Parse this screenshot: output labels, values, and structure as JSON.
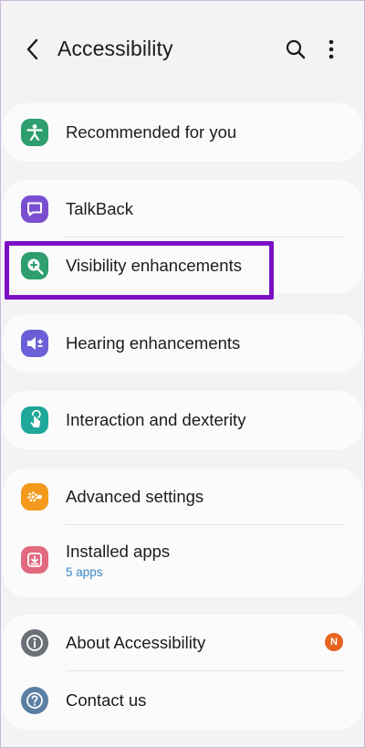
{
  "header": {
    "title": "Accessibility",
    "back_icon": "chevron-left-icon",
    "search_icon": "search-icon",
    "more_icon": "more-vertical-icon"
  },
  "sections": {
    "recommended": {
      "label": "Recommended for you",
      "icon": "accessibility-person-icon",
      "color": "#2e9e6f"
    },
    "talkback": {
      "label": "TalkBack",
      "icon": "chat-bubble-icon",
      "color": "#7a4fcf"
    },
    "visibility": {
      "label": "Visibility enhancements",
      "icon": "zoom-in-icon",
      "color": "#2e9e6f"
    },
    "hearing": {
      "label": "Hearing enhancements",
      "icon": "volume-icon",
      "color": "#6a5fd6"
    },
    "interaction": {
      "label": "Interaction and dexterity",
      "icon": "touch-hand-icon",
      "color": "#1fa89a"
    },
    "advanced": {
      "label": "Advanced settings",
      "icon": "gears-icon",
      "color": "#f39a1d"
    },
    "installed": {
      "label": "Installed apps",
      "sublabel": "5 apps",
      "icon": "download-icon",
      "color": "#e26a7e"
    },
    "about": {
      "label": "About Accessibility",
      "icon": "info-icon",
      "color": "#6b6f76",
      "badge": "N"
    },
    "contact": {
      "label": "Contact us",
      "icon": "question-icon",
      "color": "#5a7fa3"
    }
  },
  "colors": {
    "highlight": "#7a10c6",
    "badge": "#e8641e",
    "link": "#3a86c8"
  }
}
